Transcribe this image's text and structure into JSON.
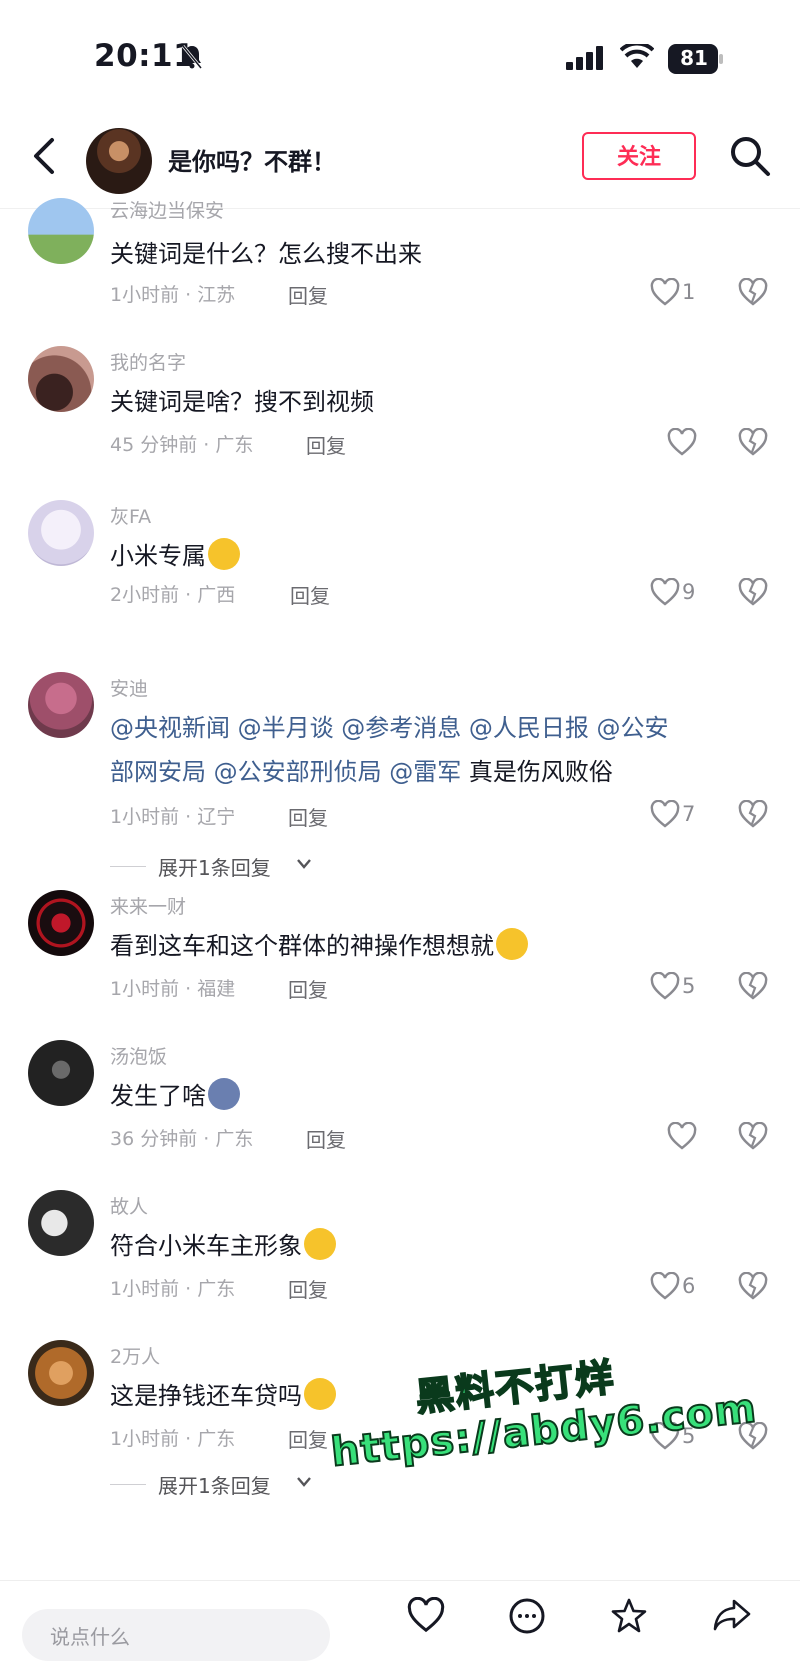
{
  "status_bar": {
    "time": "20:11",
    "battery": "81"
  },
  "header": {
    "title": "是你吗？不群！",
    "follow_label": "关注"
  },
  "comments": [
    {
      "name": "云海边当保安",
      "text": "关键词是什么？怎么搜不出来",
      "meta": "1小时前 · 江苏",
      "reply": "回复",
      "likes": "1"
    },
    {
      "name": "我的名字",
      "text": "关键词是啥？搜不到视频",
      "meta": "45 分钟前 · 广东",
      "reply": "回复",
      "likes": ""
    },
    {
      "name": "灰FA",
      "text": "小米专属",
      "meta": "2小时前 · 广西",
      "reply": "回复",
      "likes": "9"
    },
    {
      "name": "安迪",
      "mentions_line1": "@央视新闻 @半月谈 @参考消息 @人民日报 @公安",
      "mentions_line2": "部网安局 @公安部刑侦局 @雷军",
      "text_tail": "真是伤风败俗",
      "meta": "1小时前 · 辽宁",
      "reply": "回复",
      "likes": "7",
      "expand": "展开1条回复"
    },
    {
      "name": "来来一财",
      "text": "看到这车和这个群体的神操作想想就",
      "meta": "1小时前 · 福建",
      "reply": "回复",
      "likes": "5"
    },
    {
      "name": "汤泡饭",
      "text": "发生了啥",
      "meta": "36 分钟前 · 广东",
      "reply": "回复",
      "likes": ""
    },
    {
      "name": "故人",
      "text": "符合小米车主形象",
      "meta": "1小时前 · 广东",
      "reply": "回复",
      "likes": "6"
    },
    {
      "name": "2万人",
      "text": "这是挣钱还车贷吗",
      "meta": "1小时前 · 广东",
      "reply": "回复",
      "likes": "5",
      "expand": "展开1条回复"
    }
  ],
  "watermark": {
    "line1": "黑料不打烊",
    "line2": "https://abdy6.com"
  },
  "bottom_bar": {
    "placeholder": "说点什么"
  },
  "icons": {
    "bell": "bell-slash-icon",
    "signal": "signal-icon",
    "wifi": "wifi-icon",
    "battery": "battery-icon",
    "back": "back-icon",
    "search": "search-icon",
    "like": "heart-icon",
    "dislike": "broken-heart-icon",
    "chevron": "chevron-down-icon",
    "comment": "comment-icon",
    "star": "star-icon",
    "share": "share-icon"
  },
  "colors": {
    "accent": "#fe2c55",
    "mention": "#3f5f8f",
    "meta": "#a6a6ab",
    "watermark": "#38e07a"
  }
}
